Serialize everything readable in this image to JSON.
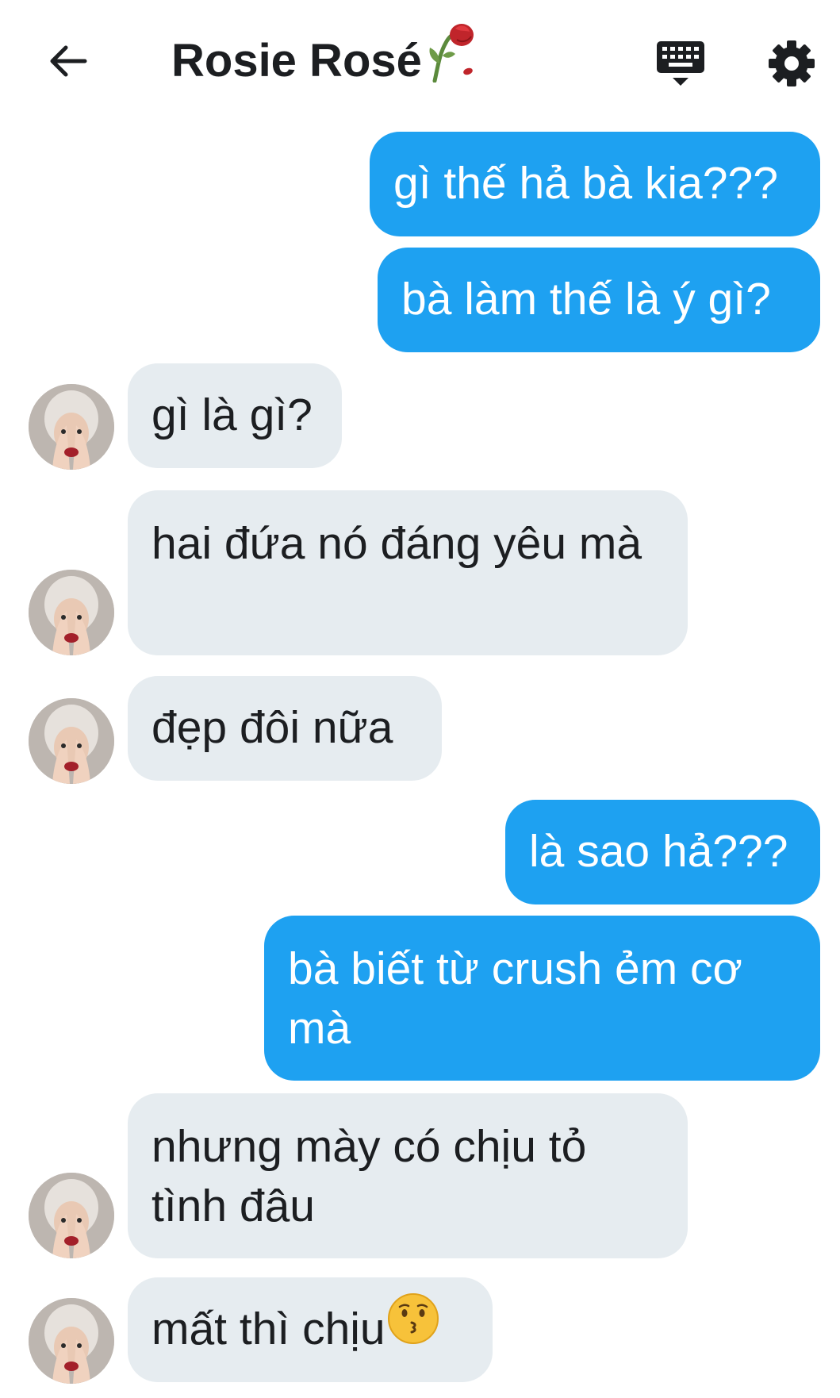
{
  "header": {
    "title": "Rosie Rosé",
    "title_emoji_icon": "wilted-rose-icon",
    "back_icon": "arrow-left-icon",
    "keyboard_icon": "keyboard-icon",
    "settings_icon": "gear-icon"
  },
  "colors": {
    "outgoing_bubble": "#1ea1f1",
    "incoming_bubble": "#e6ecf0",
    "title_text": "#1c1e21"
  },
  "messages": [
    {
      "side": "out",
      "text": "gì thế hả bà kia???"
    },
    {
      "side": "out",
      "text": "bà làm thế là ý gì?"
    },
    {
      "side": "in",
      "text": "gì là gì?"
    },
    {
      "side": "in",
      "text": "hai đứa nó đáng yêu mà"
    },
    {
      "side": "in",
      "text": "đẹp đôi nữa"
    },
    {
      "side": "out",
      "text": "là sao hả???"
    },
    {
      "side": "out",
      "text": "bà biết từ crush ẻm cơ mà"
    },
    {
      "side": "in",
      "text": "nhưng mày có chịu tỏ tình đâu"
    },
    {
      "side": "in",
      "text": "mất thì chịu",
      "emoji_icon": "kissing-face-icon"
    }
  ]
}
